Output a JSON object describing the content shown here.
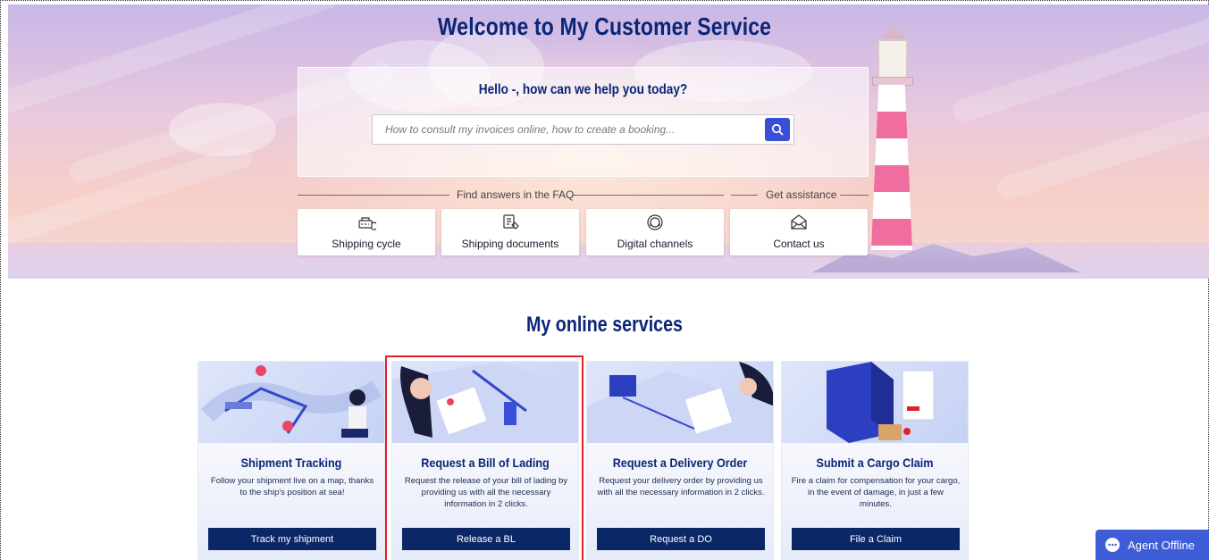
{
  "hero": {
    "title": "Welcome to My Customer Service",
    "greeting": "Hello -, how can we help you today?",
    "search_placeholder": "How to consult my invoices online, how to create a booking...",
    "faq_label": "Find answers in the FAQ",
    "assist_label": "Get assistance",
    "cards": [
      {
        "label": "Shipping cycle",
        "icon": "shipping-cycle-icon"
      },
      {
        "label": "Shipping documents",
        "icon": "documents-icon"
      },
      {
        "label": "Digital channels",
        "icon": "headset-icon"
      },
      {
        "label": "Contact us",
        "icon": "mail-icon"
      }
    ]
  },
  "services": {
    "title": "My online services",
    "items": [
      {
        "title": "Shipment Tracking",
        "desc": "Follow your shipment live on a map, thanks to the ship's position at sea!",
        "button": "Track my shipment"
      },
      {
        "title": "Request a Bill of Lading",
        "desc": "Request the release of your bill of lading by providing us with all the necessary information in 2 clicks.",
        "button": "Release a BL"
      },
      {
        "title": "Request a Delivery Order",
        "desc": "Request your delivery order by providing us with all the necessary information in 2 clicks.",
        "button": "Request a DO"
      },
      {
        "title": "Submit a Cargo Claim",
        "desc": "Fire a claim for compensation for your cargo, in the event of damage, in just a few minutes.",
        "button": "File a Claim"
      }
    ]
  },
  "agent": {
    "label": "Agent Offline"
  },
  "colors": {
    "navy": "#0b2766",
    "accent": "#3a4fd8",
    "highlight": "#e12127"
  }
}
